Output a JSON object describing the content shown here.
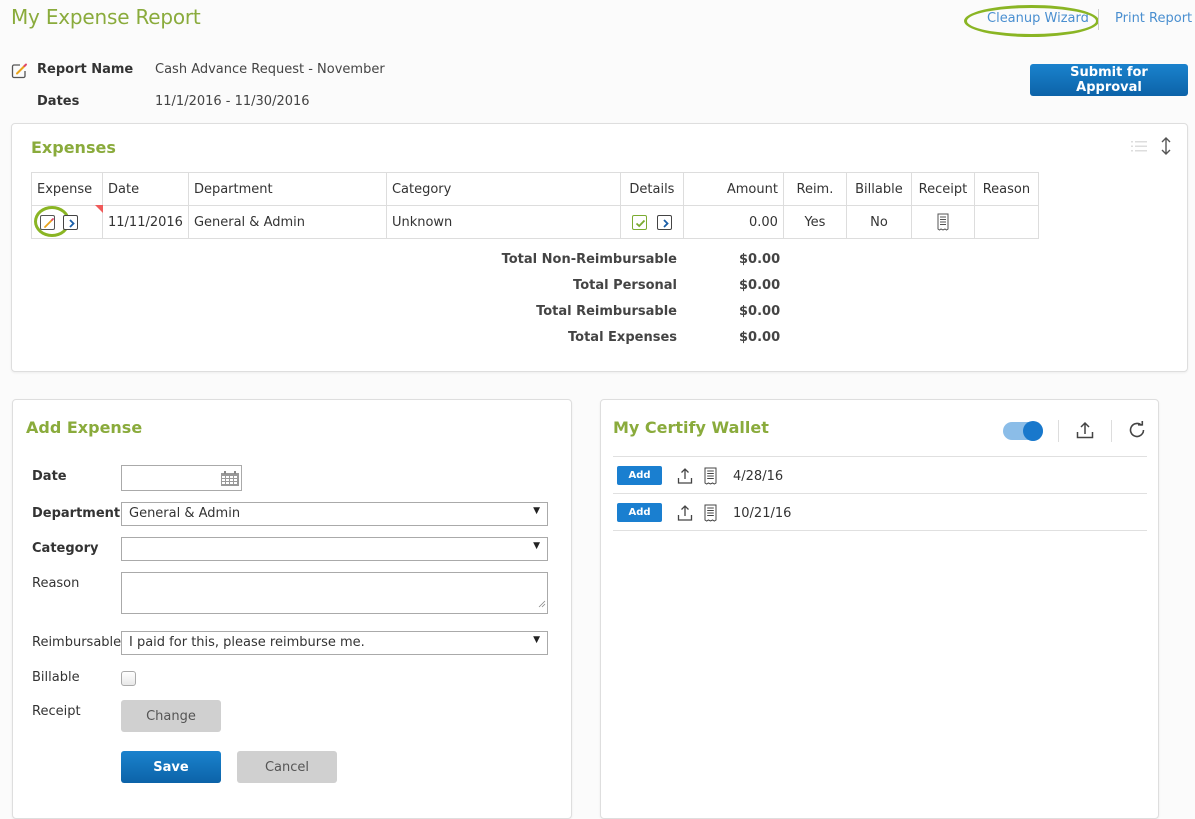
{
  "header": {
    "title": "My Expense Report",
    "links": {
      "cleanup_wizard": "Cleanup Wizard",
      "print_report": "Print Report"
    },
    "submit_button": "Submit for Approval"
  },
  "report": {
    "name_label": "Report Name",
    "name_value": "Cash Advance Request - November",
    "dates_label": "Dates",
    "dates_value": "11/1/2016 - 11/30/2016"
  },
  "expenses": {
    "title": "Expenses",
    "columns": [
      "Expense",
      "Date",
      "Department",
      "Category",
      "Details",
      "Amount",
      "Reim.",
      "Billable",
      "Receipt",
      "Reason"
    ],
    "rows": [
      {
        "date": "11/11/2016",
        "department": "General & Admin",
        "category": "Unknown",
        "amount": "0.00",
        "reimbursable": "Yes",
        "billable": "No",
        "reason": ""
      }
    ],
    "totals": [
      {
        "label": "Total Non-Reimbursable",
        "value": "$0.00"
      },
      {
        "label": "Total Personal",
        "value": "$0.00"
      },
      {
        "label": "Total Reimbursable",
        "value": "$0.00"
      },
      {
        "label": "Total Expenses",
        "value": "$0.00"
      }
    ]
  },
  "add_expense": {
    "title": "Add Expense",
    "fields": {
      "date_label": "Date",
      "date_value": "",
      "department_label": "Department",
      "department_value": "General & Admin",
      "category_label": "Category",
      "category_value": "",
      "reason_label": "Reason",
      "reason_value": "",
      "reimbursable_label": "Reimbursable",
      "reimbursable_value": "I paid for this, please reimburse me.",
      "billable_label": "Billable",
      "billable_checked": false,
      "receipt_label": "Receipt",
      "receipt_button": "Change"
    },
    "save_button": "Save",
    "cancel_button": "Cancel"
  },
  "wallet": {
    "title": "My Certify Wallet",
    "toggle_on": true,
    "items": [
      {
        "add_label": "Add",
        "date": "4/28/16"
      },
      {
        "add_label": "Add",
        "date": "10/21/16"
      }
    ]
  },
  "colors": {
    "accent_green": "#8aab3c",
    "primary_blue": "#1a82cd",
    "link_blue": "#4a8fd0",
    "highlight_green": "#8ab524"
  }
}
